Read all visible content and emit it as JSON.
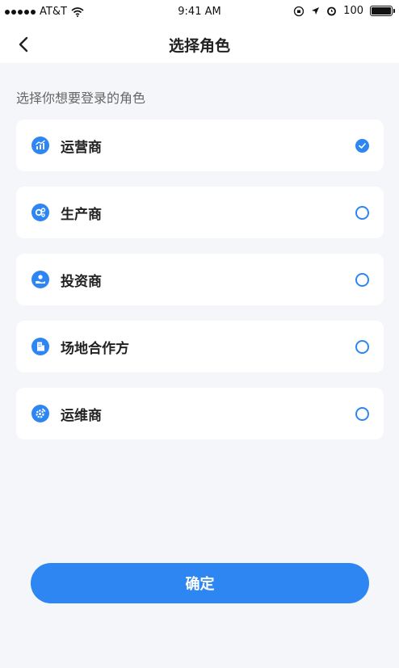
{
  "status_bar": {
    "carrier": "AT&T",
    "time": "9:41 AM",
    "battery_level": "100"
  },
  "nav": {
    "title": "选择角色"
  },
  "subtitle": "选择你想要登录的角色",
  "roles": [
    {
      "label": "运营商",
      "icon": "chart-icon",
      "selected": true
    },
    {
      "label": "生产商",
      "icon": "gears-icon",
      "selected": false
    },
    {
      "label": "投资商",
      "icon": "investor-icon",
      "selected": false
    },
    {
      "label": "场地合作方",
      "icon": "building-icon",
      "selected": false
    },
    {
      "label": "运维商",
      "icon": "maintenance-icon",
      "selected": false
    }
  ],
  "confirm_label": "确定",
  "colors": {
    "accent": "#2e86f3",
    "background": "#f5f6f9",
    "card": "#ffffff"
  }
}
